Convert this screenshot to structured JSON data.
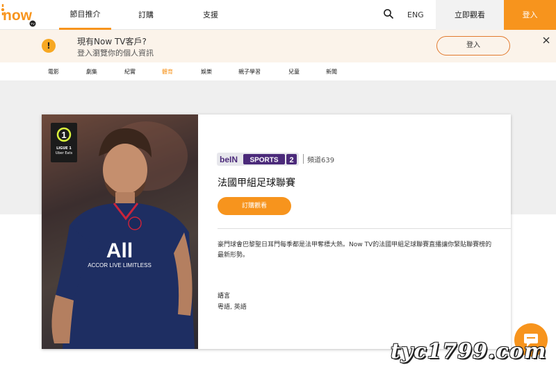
{
  "header": {
    "brand": "now",
    "brand_sub": "TV",
    "nav": [
      "節目推介",
      "訂購",
      "支援"
    ],
    "lang": "ENG",
    "watch_label": "立即觀看",
    "login_label": "登入"
  },
  "banner": {
    "title": "現有Now TV客戶?",
    "subtitle": "登入瀏覽你的個人資訊",
    "login_label": "登入"
  },
  "categories": [
    "電影",
    "劇集",
    "紀實",
    "體育",
    "娛樂",
    "親子學習",
    "兒童",
    "新聞"
  ],
  "active_category": "體育",
  "program": {
    "badge_line1": "LIGUE 1",
    "badge_line2": "Uber Eats",
    "channel_brand": "beIN SPORTS 2",
    "channel_num": "頻道639",
    "title": "法國甲組足球聯賽",
    "subscribe_label": "訂購觀看",
    "description": "豪門球會巴黎聖日耳門每季都是法甲奪標大熱。Now TV的法國甲組足球聯賽直播讓你緊貼聯賽榜的最新形勢。",
    "language_heading": "語言",
    "languages": "粵語, 英語"
  },
  "watermark": "tyc1799.com",
  "colors": {
    "accent": "#f7941d",
    "banner_bg": "#fbf3ea",
    "bein_purple": "#4b2a7a"
  }
}
